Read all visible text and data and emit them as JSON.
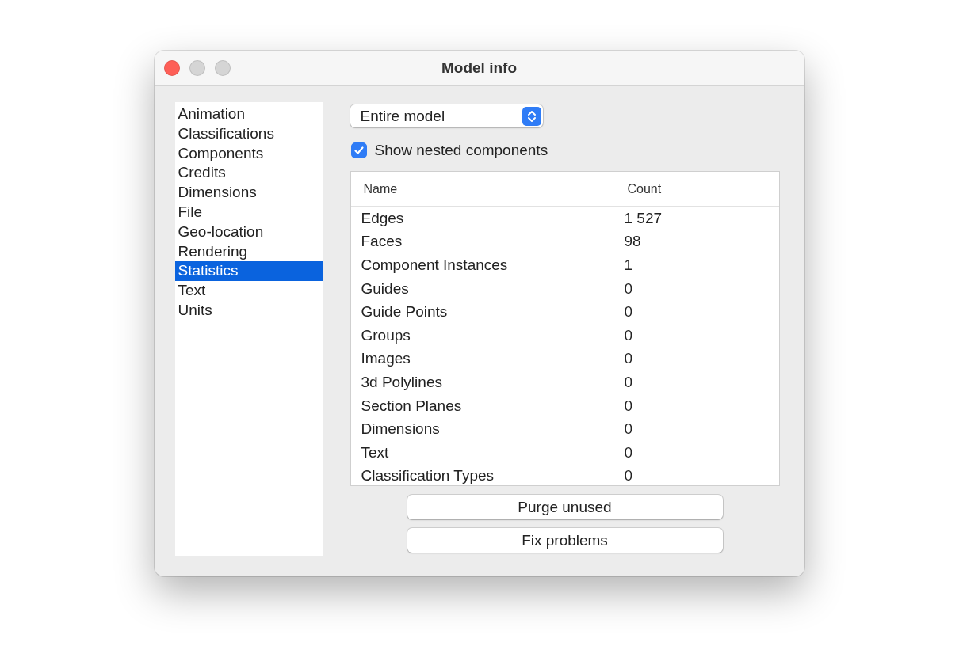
{
  "window": {
    "title": "Model info"
  },
  "sidebar": {
    "items": [
      {
        "label": "Animation",
        "selected": false
      },
      {
        "label": "Classifications",
        "selected": false
      },
      {
        "label": "Components",
        "selected": false
      },
      {
        "label": "Credits",
        "selected": false
      },
      {
        "label": "Dimensions",
        "selected": false
      },
      {
        "label": "File",
        "selected": false
      },
      {
        "label": "Geo-location",
        "selected": false
      },
      {
        "label": "Rendering",
        "selected": false
      },
      {
        "label": "Statistics",
        "selected": true
      },
      {
        "label": "Text",
        "selected": false
      },
      {
        "label": "Units",
        "selected": false
      }
    ]
  },
  "scope_select": {
    "value": "Entire model"
  },
  "show_nested": {
    "label": "Show nested components",
    "checked": true
  },
  "table": {
    "columns": [
      "Name",
      "Count"
    ],
    "rows": [
      [
        "Edges",
        "1 527"
      ],
      [
        "Faces",
        "98"
      ],
      [
        "Component Instances",
        "1"
      ],
      [
        "Guides",
        "0"
      ],
      [
        "Guide Points",
        "0"
      ],
      [
        "Groups",
        "0"
      ],
      [
        "Images",
        "0"
      ],
      [
        "3d Polylines",
        "0"
      ],
      [
        "Section Planes",
        "0"
      ],
      [
        "Dimensions",
        "0"
      ],
      [
        "Text",
        "0"
      ],
      [
        "Classification Types",
        "0"
      ]
    ]
  },
  "buttons": [
    "Purge unused",
    "Fix problems"
  ]
}
